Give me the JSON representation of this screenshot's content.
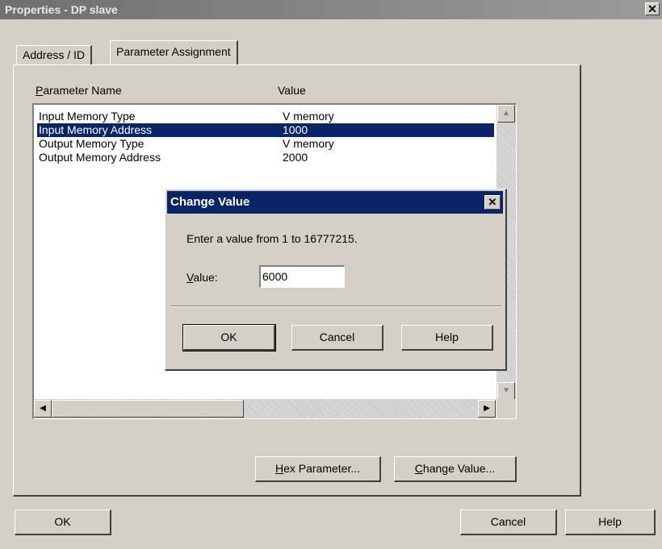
{
  "window": {
    "title": "Properties - DP slave",
    "close_glyph": "✕"
  },
  "tabs": [
    {
      "label": "Address / ID",
      "active": false
    },
    {
      "label": "Parameter Assignment",
      "active": true
    }
  ],
  "params": {
    "columns": {
      "name_accel": "P",
      "name_rest": "arameter Name",
      "value": "Value"
    },
    "rows": [
      {
        "name": "Input Memory Type",
        "value": "V memory",
        "selected": false
      },
      {
        "name": "Input Memory Address",
        "value": "1000",
        "selected": true
      },
      {
        "name": "Output Memory Type",
        "value": "V memory",
        "selected": false
      },
      {
        "name": "Output Memory Address",
        "value": "2000",
        "selected": false
      }
    ],
    "buttons": {
      "hex_accel": "H",
      "hex_rest": "ex Parameter...",
      "change_accel": "C",
      "change_rest": "hange Value..."
    }
  },
  "footer": {
    "ok": "OK",
    "cancel": "Cancel",
    "help": "Help"
  },
  "dialog": {
    "title": "Change Value",
    "close_glyph": "✕",
    "message": "Enter a value from 1  to  16777215.",
    "label_accel": "V",
    "label_rest": "alue:",
    "value": "6000",
    "ok": "OK",
    "cancel": "Cancel",
    "help": "Help"
  },
  "scroll_glyphs": {
    "up": "▲",
    "down": "▼",
    "left": "◀",
    "right": "▶"
  }
}
